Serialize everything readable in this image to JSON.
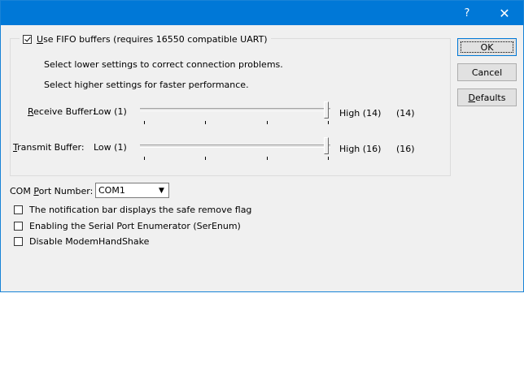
{
  "titlebar": {
    "help": "?",
    "close": "✕"
  },
  "fifo": {
    "label_u": "U",
    "label_rest": "se FIFO buffers (requires 16550 compatible UART)",
    "checked": true,
    "hint_low": "Select lower settings to correct connection problems.",
    "hint_high": "Select higher settings for faster performance."
  },
  "receive": {
    "label_u": "R",
    "label_rest": "eceive Buffer:",
    "low": "Low (1)",
    "high": "High (14)",
    "value": "(14)",
    "level": 14,
    "min": 1,
    "max": 14
  },
  "transmit": {
    "label_u": "T",
    "label_rest": "ransmit Buffer:",
    "low": "Low (1)",
    "high": "High (16)",
    "value": "(16)",
    "level": 16,
    "min": 1,
    "max": 16
  },
  "com": {
    "label_a": "COM ",
    "label_u": "P",
    "label_b": "ort Number:",
    "value": "COM1"
  },
  "options": [
    {
      "label": "The notification bar displays the safe remove flag",
      "checked": false
    },
    {
      "label": "Enabling the Serial Port Enumerator (SerEnum)",
      "checked": false
    },
    {
      "label": "Disable ModemHandShake",
      "checked": false
    }
  ],
  "buttons": {
    "ok": "OK",
    "cancel": "Cancel",
    "defaults_u": "D",
    "defaults_rest": "efaults"
  }
}
